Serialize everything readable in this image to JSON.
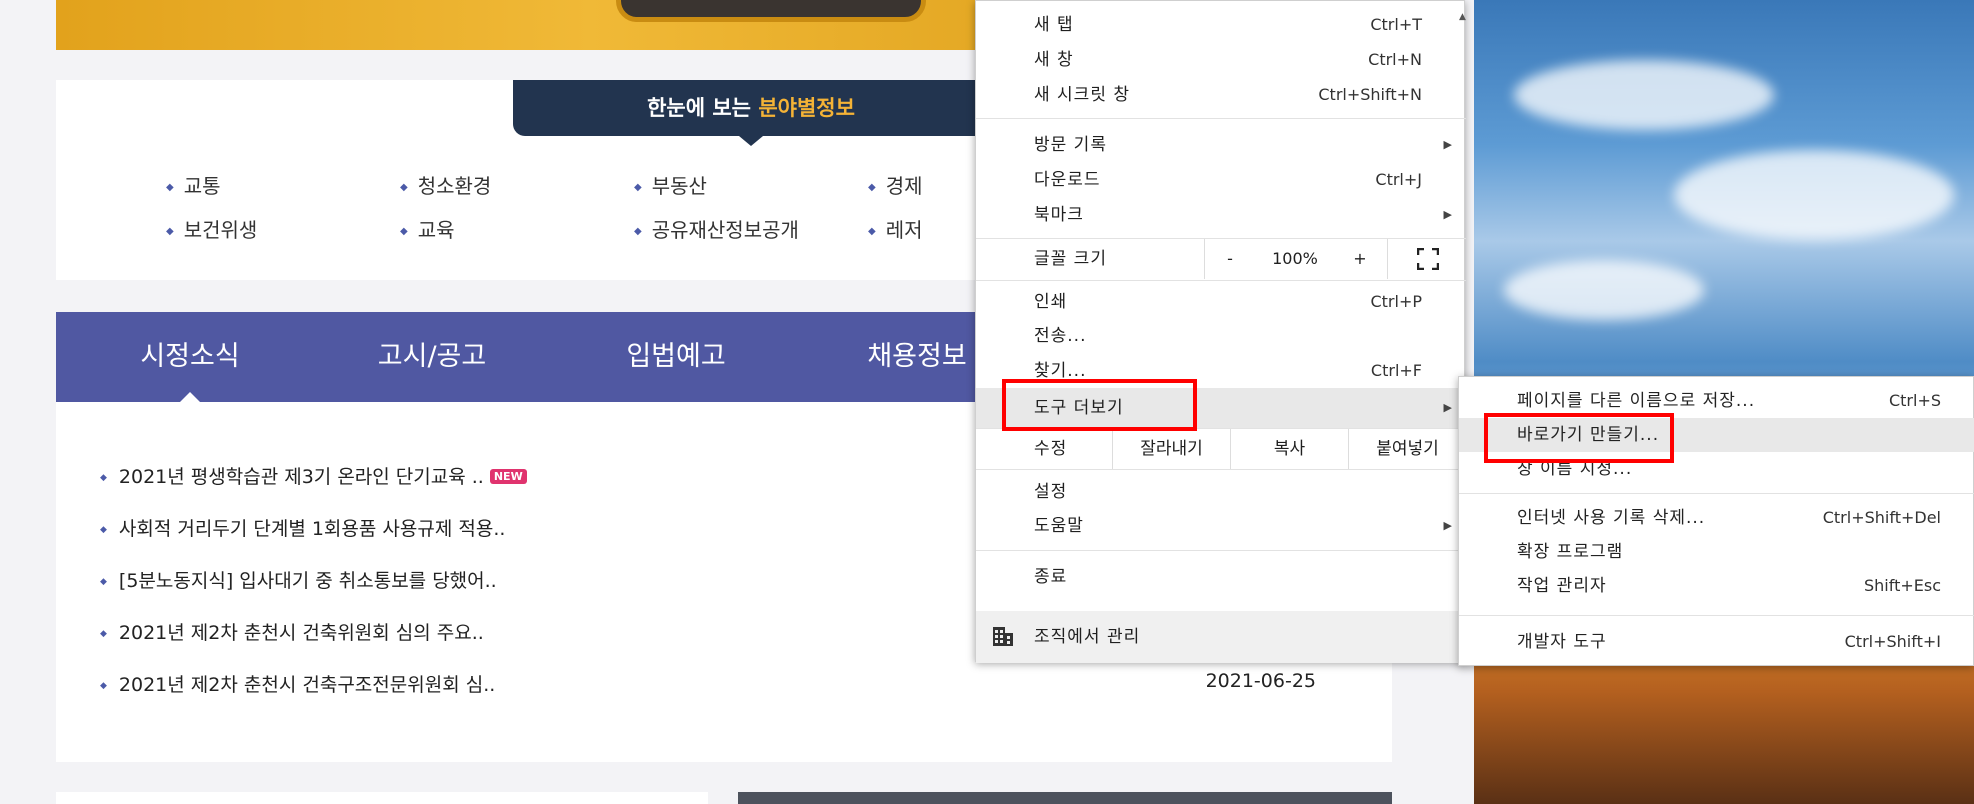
{
  "field_info": {
    "title_prefix": "한눈에 보는 ",
    "title_highlight": "분야별정보",
    "items": [
      "교통",
      "청소환경",
      "부동산",
      "경제",
      "보건위생",
      "교육",
      "공유재산정보공개",
      "레저"
    ]
  },
  "news": {
    "tabs": [
      "시정소식",
      "고시/공고",
      "입법예고",
      "채용정보"
    ],
    "new_badge": "NEW",
    "items": [
      {
        "title": "2021년 평생학습관 제3기 온라인 단기교육 ..",
        "date": ""
      },
      {
        "title": "사회적 거리두기 단계별 1회용품 사용규제 적용..",
        "date": ""
      },
      {
        "title": "[5분노동지식] 입사대기 중 취소통보를 당했어..",
        "date": ""
      },
      {
        "title": "2021년 제2차 춘천시 건축위원회 심의 주요..",
        "date": ""
      },
      {
        "title": "2021년 제2차 춘천시 건축구조전문위원회 심..",
        "date": "2021-06-25"
      }
    ]
  },
  "menu": {
    "new_tab": {
      "label": "새 탭",
      "shortcut": "Ctrl+T"
    },
    "new_window": {
      "label": "새 창",
      "shortcut": "Ctrl+N"
    },
    "incognito": {
      "label": "새 시크릿 창",
      "shortcut": "Ctrl+Shift+N"
    },
    "history": {
      "label": "방문 기록"
    },
    "downloads": {
      "label": "다운로드",
      "shortcut": "Ctrl+J"
    },
    "bookmarks": {
      "label": "북마크"
    },
    "zoom": {
      "label": "글꼴 크기",
      "minus": "-",
      "value": "100%",
      "plus": "+"
    },
    "print": {
      "label": "인쇄",
      "shortcut": "Ctrl+P"
    },
    "cast": {
      "label": "전송..."
    },
    "find": {
      "label": "찾기...",
      "shortcut": "Ctrl+F"
    },
    "more_tools": {
      "label": "도구 더보기"
    },
    "edit": {
      "label": "수정",
      "cut": "잘라내기",
      "copy": "복사",
      "paste": "붙여넣기"
    },
    "settings": {
      "label": "설정"
    },
    "help": {
      "label": "도움말"
    },
    "exit": {
      "label": "종료"
    },
    "managed": {
      "label": "조직에서 관리"
    }
  },
  "submenu": {
    "save_as": {
      "label": "페이지를 다른 이름으로 저장...",
      "shortcut": "Ctrl+S"
    },
    "create_shortcut": {
      "label": "바로가기 만들기..."
    },
    "name_window": {
      "label": "창 이름 지정..."
    },
    "clear_data": {
      "label": "인터넷 사용 기록 삭제...",
      "shortcut": "Ctrl+Shift+Del"
    },
    "extensions": {
      "label": "확장 프로그램"
    },
    "task_manager": {
      "label": "작업 관리자",
      "shortcut": "Shift+Esc"
    },
    "dev_tools": {
      "label": "개발자 도구",
      "shortcut": "Ctrl+Shift+I"
    }
  },
  "colors": {
    "nav_blue": "#5058a2",
    "title_navy": "#22344f",
    "highlight_orange": "#f5b336",
    "annotation_red": "#ff0000",
    "new_badge_pink": "#e0336e"
  }
}
